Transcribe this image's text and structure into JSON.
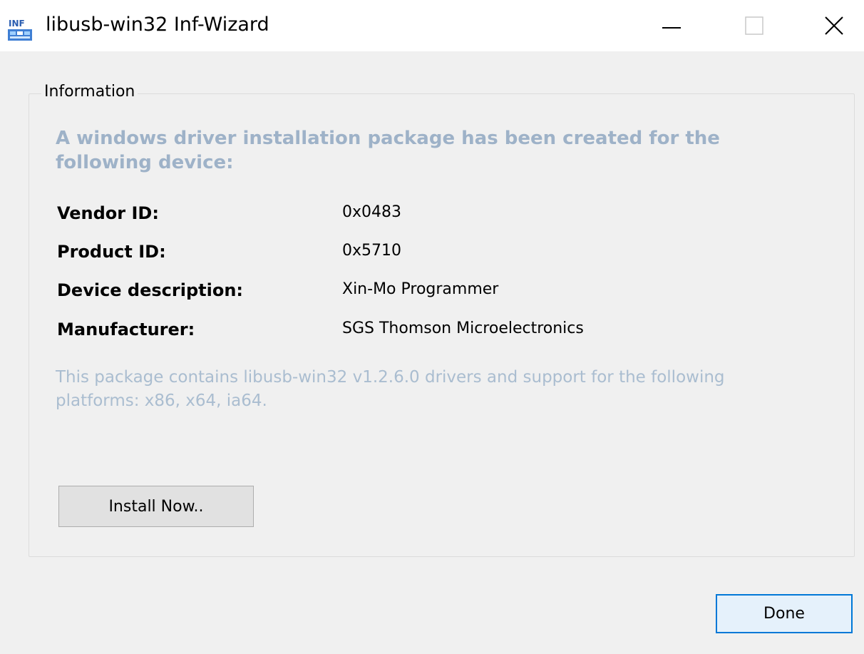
{
  "window": {
    "title": "libusb-win32 Inf-Wizard",
    "icon": "inf-icon",
    "controls": [
      "minimize-icon",
      "maximize-icon",
      "close-icon"
    ]
  },
  "group": {
    "legend": "Information"
  },
  "heading": "A windows driver installation package has been created for the following device:",
  "fields": [
    {
      "label": "Vendor ID:",
      "value": "0x0483"
    },
    {
      "label": "Product ID:",
      "value": "0x5710"
    },
    {
      "label": "Device description:",
      "value": "Xin-Mo Programmer"
    },
    {
      "label": "Manufacturer:",
      "value": "SGS Thomson Microelectronics"
    }
  ],
  "note": "This package contains libusb-win32 v1.2.6.0 drivers and support for the following platforms: x86, x64, ia64.",
  "buttons": {
    "install": "Install Now..",
    "done": "Done"
  },
  "colors": {
    "heading": "#9eb2c8",
    "note": "#aabdd0",
    "focus_border": "#0078d7"
  }
}
